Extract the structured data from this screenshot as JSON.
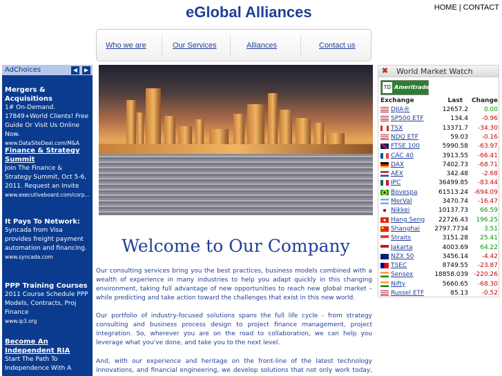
{
  "site": {
    "title": "eGlobal Alliances"
  },
  "top_links": {
    "home": "HOME",
    "separator": "|",
    "contact": "CONTACT"
  },
  "nav": {
    "items": [
      "Who we are",
      "Our Services",
      "Alliances",
      "Contact us"
    ]
  },
  "ads": {
    "ad_choices": "AdChoices",
    "prev_arrow": "◀",
    "next_arrow": "▶",
    "items": [
      {
        "title": "Mergers & Acquisitions",
        "text": "1# On-Demand. 17849+World Clients! Free Guide Or Visit Us Online Now.",
        "url": "www.DataSiteDeal.com/M&A"
      },
      {
        "title": "Finance & Strategy Summit",
        "text": "Join The Finance & Strategy Summit, Oct 5-6, 2011. Request an Invite",
        "url": "www.executiveboard.com/corp..."
      },
      {
        "title": "It Pays To Network:",
        "text": "Syncada from Visa provides freight payment automation and financing.",
        "url": "www.syncada.com"
      },
      {
        "title": "PPP Training Courses",
        "text": "2011 Course Schedule PPP Models, Contracts, Proj Finance",
        "url": "www.ip3.org"
      },
      {
        "title": "Become An Independent RIA",
        "text": "Start The Path To Independence With A",
        "url": ""
      }
    ]
  },
  "main": {
    "welcome": "Welcome to Our Company",
    "paragraphs": [
      "Our consulting services bring you the best practices, business models combined with a wealth of experience in many industries to help you adapt quickly in this changing environment, taking full advantage of new opportunities to reach new global market – while predicting and take action toward the challenges that exist in this new world.",
      "Our portfolio of industry-focused solutions spans the full life cycle - from strategy consulting and business process design to project finance management, project integration. So, wherever you are on the road to collaboration, we can help you leverage what you've done, and take you to the next level.",
      "And, with our experience and heritage on the front-line of the latest technology innovations, and financial engineering, we develop solutions that not only work today, but also are adaptable to meet"
    ]
  },
  "market_watch": {
    "close_glyph": "✖",
    "title": "World Market Watch",
    "logo_box": "TD",
    "logo_name": "Ameritrade",
    "columns": {
      "exchange": "Exchange",
      "last": "Last",
      "change": "Change"
    },
    "colors": {
      "up": "#009900",
      "down": "#cc0000"
    },
    "rows": [
      {
        "name": "DJIA®",
        "last": "12657.2",
        "change": "0.00",
        "dir": "up",
        "flag": "us"
      },
      {
        "name": "SP500 ETF",
        "last": "134.4",
        "change": "-0.96",
        "dir": "down",
        "flag": "us"
      },
      {
        "name": "TSX",
        "last": "13371.7",
        "change": "-34.30",
        "dir": "down",
        "flag": "ca"
      },
      {
        "name": "NDQ ETF",
        "last": "59.03",
        "change": "-0.16",
        "dir": "down",
        "flag": "us"
      },
      {
        "name": "FTSE 100",
        "last": "5990.58",
        "change": "-63.97",
        "dir": "down",
        "flag": "uk"
      },
      {
        "name": "CAC 40",
        "last": "3913.55",
        "change": "-66.41",
        "dir": "down",
        "flag": "fr"
      },
      {
        "name": "DAX",
        "last": "7402.73",
        "change": "-68.71",
        "dir": "down",
        "flag": "de"
      },
      {
        "name": "AEX",
        "last": "342.48",
        "change": "-2.68",
        "dir": "down",
        "flag": "nl"
      },
      {
        "name": "IPC",
        "last": "36499.85",
        "change": "-83.44",
        "dir": "down",
        "flag": "mx"
      },
      {
        "name": "Bovespa",
        "last": "61513.24",
        "change": "-694.09",
        "dir": "down",
        "flag": "br"
      },
      {
        "name": "MerVal",
        "last": "3470.74",
        "change": "-16.47",
        "dir": "down",
        "flag": "ar"
      },
      {
        "name": "Nikkei",
        "last": "10137.73",
        "change": "66.59",
        "dir": "up",
        "flag": "jp"
      },
      {
        "name": "Hang Seng",
        "last": "22726.43",
        "change": "196.25",
        "dir": "up",
        "flag": "hk"
      },
      {
        "name": "Shanghai",
        "last": "2797.7734",
        "change": "3.51",
        "dir": "up",
        "flag": "cn"
      },
      {
        "name": "Straits",
        "last": "3151.28",
        "change": "25.41",
        "dir": "up",
        "flag": "sg"
      },
      {
        "name": "Jakarta",
        "last": "4003.69",
        "change": "64.22",
        "dir": "up",
        "flag": "id"
      },
      {
        "name": "NZX 50",
        "last": "3456.14",
        "change": "-4.42",
        "dir": "down",
        "flag": "nz"
      },
      {
        "name": "TSEC",
        "last": "8749.55",
        "change": "-23.87",
        "dir": "down",
        "flag": "tw"
      },
      {
        "name": "Sensex",
        "last": "18858.039",
        "change": "-220.26",
        "dir": "down",
        "flag": "in"
      },
      {
        "name": "Nifty",
        "last": "5660.65",
        "change": "-68.30",
        "dir": "down",
        "flag": "in"
      },
      {
        "name": "Russel ETF",
        "last": "85.13",
        "change": "-0.52",
        "dir": "down",
        "flag": "us"
      }
    ]
  }
}
